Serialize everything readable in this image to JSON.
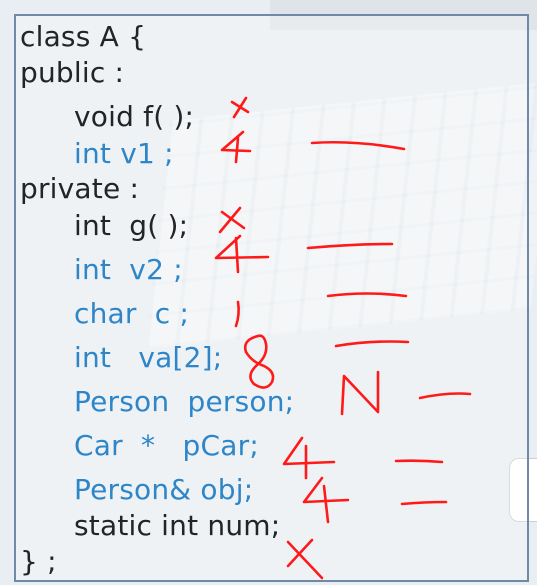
{
  "code": {
    "lines": [
      "class A {",
      "public :",
      "void f( );",
      "int v1 ;",
      "private :",
      "int  g( );",
      "int  v2 ;",
      "char  c ;",
      "int   va[2];",
      "Person  person;",
      "Car  *   pCar;",
      "Person& obj;",
      "static int num;",
      "} ;"
    ]
  },
  "annotations": {
    "handwritten_marks": [
      "x",
      "4",
      "x",
      "4",
      "1",
      "8",
      "N",
      "4",
      "4",
      "x"
    ]
  },
  "colors": {
    "code_text": "#222426",
    "member_highlight": "#2e86c8",
    "ink": "#ff1a1a",
    "border": "#6f8aa6"
  }
}
